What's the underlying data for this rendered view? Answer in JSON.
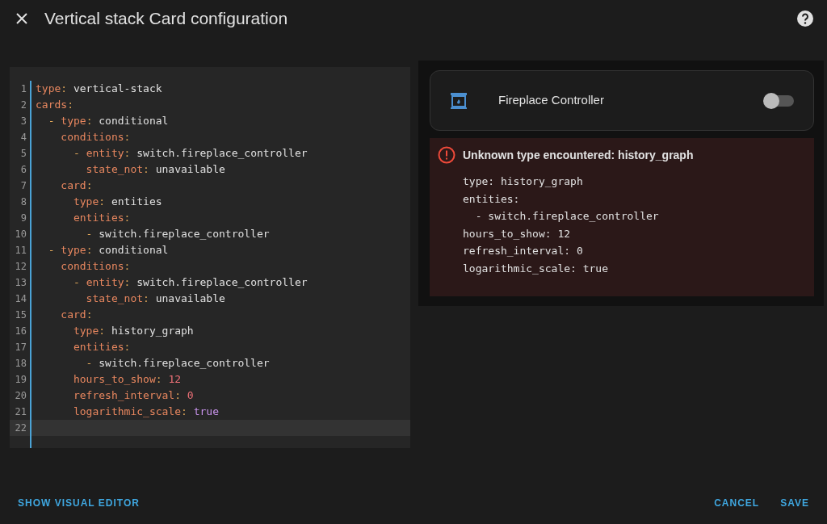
{
  "dialog": {
    "title": "Vertical stack Card configuration"
  },
  "editor": {
    "lines": [
      {
        "number": "1",
        "active": false,
        "tokens": [
          {
            "kind": "key",
            "text": "type"
          },
          {
            "kind": "punct",
            "text": ": "
          },
          {
            "kind": "value",
            "text": "vertical-stack"
          }
        ]
      },
      {
        "number": "2",
        "active": false,
        "tokens": [
          {
            "kind": "key",
            "text": "cards"
          },
          {
            "kind": "punct",
            "text": ":"
          }
        ]
      },
      {
        "number": "3",
        "active": false,
        "tokens": [
          {
            "kind": "punct",
            "text": "  - "
          },
          {
            "kind": "key",
            "text": "type"
          },
          {
            "kind": "punct",
            "text": ": "
          },
          {
            "kind": "value",
            "text": "conditional"
          }
        ]
      },
      {
        "number": "4",
        "active": false,
        "tokens": [
          {
            "kind": "key",
            "text": "    conditions"
          },
          {
            "kind": "punct",
            "text": ":"
          }
        ]
      },
      {
        "number": "5",
        "active": false,
        "tokens": [
          {
            "kind": "punct",
            "text": "      - "
          },
          {
            "kind": "key",
            "text": "entity"
          },
          {
            "kind": "punct",
            "text": ": "
          },
          {
            "kind": "value",
            "text": "switch.fireplace_controller"
          }
        ]
      },
      {
        "number": "6",
        "active": false,
        "tokens": [
          {
            "kind": "key",
            "text": "        state_not"
          },
          {
            "kind": "punct",
            "text": ": "
          },
          {
            "kind": "value",
            "text": "unavailable"
          }
        ]
      },
      {
        "number": "7",
        "active": false,
        "tokens": [
          {
            "kind": "key",
            "text": "    card"
          },
          {
            "kind": "punct",
            "text": ":"
          }
        ]
      },
      {
        "number": "8",
        "active": false,
        "tokens": [
          {
            "kind": "key",
            "text": "      type"
          },
          {
            "kind": "punct",
            "text": ": "
          },
          {
            "kind": "value",
            "text": "entities"
          }
        ]
      },
      {
        "number": "9",
        "active": false,
        "tokens": [
          {
            "kind": "key",
            "text": "      entities"
          },
          {
            "kind": "punct",
            "text": ":"
          }
        ]
      },
      {
        "number": "10",
        "active": false,
        "tokens": [
          {
            "kind": "punct",
            "text": "        - "
          },
          {
            "kind": "value",
            "text": "switch.fireplace_controller"
          }
        ]
      },
      {
        "number": "11",
        "active": false,
        "tokens": [
          {
            "kind": "punct",
            "text": "  - "
          },
          {
            "kind": "key",
            "text": "type"
          },
          {
            "kind": "punct",
            "text": ": "
          },
          {
            "kind": "value",
            "text": "conditional"
          }
        ]
      },
      {
        "number": "12",
        "active": false,
        "tokens": [
          {
            "kind": "key",
            "text": "    conditions"
          },
          {
            "kind": "punct",
            "text": ":"
          }
        ]
      },
      {
        "number": "13",
        "active": false,
        "tokens": [
          {
            "kind": "punct",
            "text": "      - "
          },
          {
            "kind": "key",
            "text": "entity"
          },
          {
            "kind": "punct",
            "text": ": "
          },
          {
            "kind": "value",
            "text": "switch.fireplace_controller"
          }
        ]
      },
      {
        "number": "14",
        "active": false,
        "tokens": [
          {
            "kind": "key",
            "text": "        state_not"
          },
          {
            "kind": "punct",
            "text": ": "
          },
          {
            "kind": "value",
            "text": "unavailable"
          }
        ]
      },
      {
        "number": "15",
        "active": false,
        "tokens": [
          {
            "kind": "key",
            "text": "    card"
          },
          {
            "kind": "punct",
            "text": ":"
          }
        ]
      },
      {
        "number": "16",
        "active": false,
        "tokens": [
          {
            "kind": "key",
            "text": "      type"
          },
          {
            "kind": "punct",
            "text": ": "
          },
          {
            "kind": "value",
            "text": "history_graph"
          }
        ]
      },
      {
        "number": "17",
        "active": false,
        "tokens": [
          {
            "kind": "key",
            "text": "      entities"
          },
          {
            "kind": "punct",
            "text": ":"
          }
        ]
      },
      {
        "number": "18",
        "active": false,
        "tokens": [
          {
            "kind": "punct",
            "text": "        - "
          },
          {
            "kind": "value",
            "text": "switch.fireplace_controller"
          }
        ]
      },
      {
        "number": "19",
        "active": false,
        "tokens": [
          {
            "kind": "key",
            "text": "      hours_to_show"
          },
          {
            "kind": "punct",
            "text": ": "
          },
          {
            "kind": "number",
            "text": "12"
          }
        ]
      },
      {
        "number": "20",
        "active": false,
        "tokens": [
          {
            "kind": "key",
            "text": "      refresh_interval"
          },
          {
            "kind": "punct",
            "text": ": "
          },
          {
            "kind": "number",
            "text": "0"
          }
        ]
      },
      {
        "number": "21",
        "active": false,
        "tokens": [
          {
            "kind": "key",
            "text": "      logarithmic_scale"
          },
          {
            "kind": "punct",
            "text": ": "
          },
          {
            "kind": "bool",
            "text": "true"
          }
        ]
      },
      {
        "number": "22",
        "active": true
      }
    ]
  },
  "preview": {
    "entity": {
      "name": "Fireplace Controller",
      "on": false
    },
    "error": {
      "title": "Unknown type encountered: history_graph",
      "lines": [
        "type: history_graph",
        "entities:",
        "  - switch.fireplace_controller",
        "hours_to_show: 12",
        "refresh_interval: 0",
        "logarithmic_scale: true"
      ]
    }
  },
  "footer": {
    "left_button": "SHOW VISUAL EDITOR",
    "right_buttons": [
      "CANCEL",
      "SAVE"
    ]
  }
}
